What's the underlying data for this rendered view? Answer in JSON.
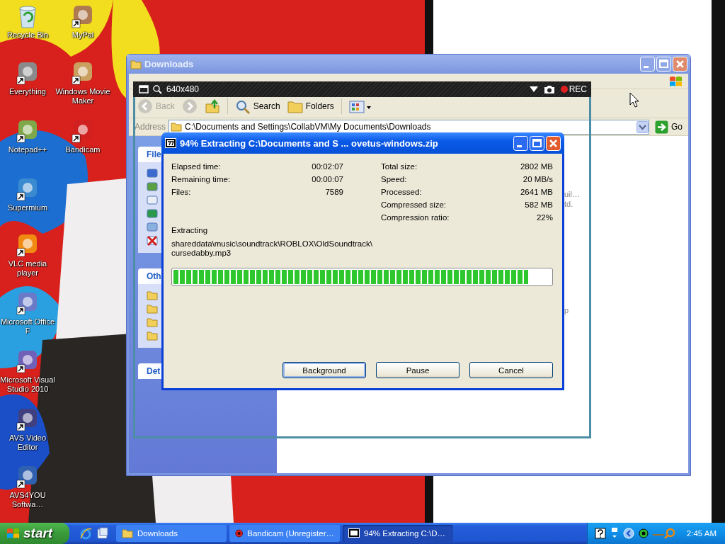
{
  "desktop_icons": [
    {
      "label": "Recycle Bin"
    },
    {
      "label": "MyPal"
    },
    {
      "label": "Everything"
    },
    {
      "label": "Windows Movie Maker"
    },
    {
      "label": "Notepad++"
    },
    {
      "label": "Bandicam"
    },
    {
      "label": "Supermium"
    },
    {
      "label": "VLC media player"
    },
    {
      "label": "Microsoft Office F"
    },
    {
      "label": "Microsoft Visual Studio 2010"
    },
    {
      "label": "AVS Video Editor"
    },
    {
      "label": "AVS4YOU Softwa…"
    }
  ],
  "explorer": {
    "title": "Downloads",
    "toolbar": [
      {
        "label": "Back",
        "disabled": true
      },
      {
        "label": "Search",
        "disabled": false
      },
      {
        "label": "Folders",
        "disabled": false
      }
    ],
    "address_label": "Address",
    "address": "C:\\Documents and Settings\\CollabVM\\My Documents\\Downloads",
    "go": "Go",
    "sidebar_panels": [
      "File",
      "Oth",
      "Det"
    ],
    "file_fragments": [
      "uil…",
      "td.",
      "p"
    ]
  },
  "bandicam": {
    "size": "640x480",
    "rec": "REC"
  },
  "dialog": {
    "title": "94% Extracting C:\\Documents and S ... ovetus-windows.zip",
    "stats_left": [
      {
        "label": "Elapsed time:",
        "value": "00:02:07"
      },
      {
        "label": "Remaining time:",
        "value": "00:00:07"
      },
      {
        "label": "Files:",
        "value": "7589"
      }
    ],
    "stats_right": [
      {
        "label": "Total size:",
        "value": "2802 MB"
      },
      {
        "label": "Speed:",
        "value": "20 MB/s"
      },
      {
        "label": "Processed:",
        "value": "2641 MB"
      },
      {
        "label": "Compressed size:",
        "value": "582 MB"
      },
      {
        "label": "Compression ratio:",
        "value": "22%"
      }
    ],
    "status_label": "Extracting",
    "current_file": "shareddata\\music\\soundtrack\\ROBLOX\\OldSoundtrack\\cursedabby.mp3",
    "progress": {
      "level": 0.94
    },
    "buttons": [
      {
        "label": "Background",
        "focused": true
      },
      {
        "label": "Pause",
        "focused": false
      },
      {
        "label": "Cancel",
        "focused": false
      }
    ]
  },
  "taskbar": {
    "start": "start",
    "tasks": [
      {
        "label": "Downloads",
        "selected": false
      },
      {
        "label": "Bandicam (Unregister…",
        "selected": false
      },
      {
        "label": "94% Extracting C:\\D…",
        "selected": true
      }
    ],
    "clock": "2:45 AM"
  }
}
